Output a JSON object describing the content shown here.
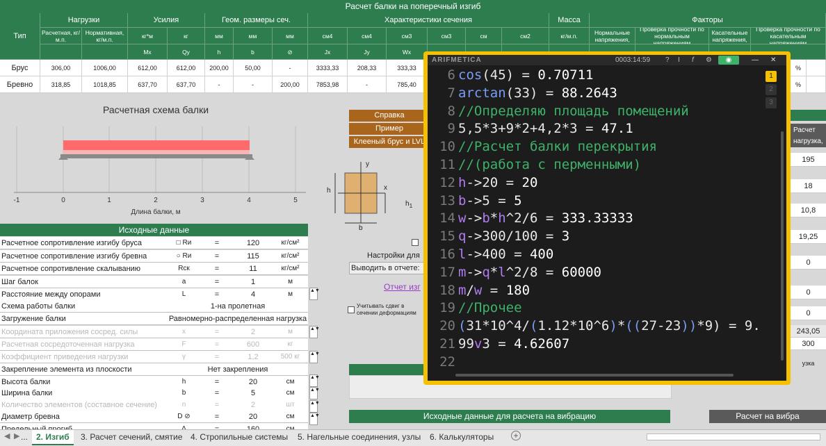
{
  "title": "Расчет балки на поперечный изгиб",
  "table_header": {
    "tip": "Тип",
    "groups": [
      "Нагрузки",
      "Усилия",
      "Геом. размеры сеч.",
      "Характеристики сечения",
      "Масса",
      "Факторы"
    ],
    "sub": [
      "Расчетная, кг/м.п.",
      "Нормативная, кг/м.п.",
      "кг*м",
      "кг",
      "мм",
      "мм",
      "мм",
      "см4",
      "см4",
      "см3",
      "см3",
      "см",
      "см2",
      "кг/м.п.",
      "Нормальные напряжения,",
      "Проверка прочности по нормальным напряжениям",
      "Касательные напряжения,",
      "Проверка прочности по касательным напряжениям"
    ],
    "sub2": [
      "",
      "",
      "Mx",
      "Qy",
      "h",
      "b",
      "⊘",
      "Jx",
      "Jy",
      "Wx"
    ]
  },
  "rows": [
    {
      "name": "Брус",
      "cells": [
        "306,00",
        "1006,00",
        "612,00",
        "612,00",
        "200,00",
        "50,00",
        "-",
        "3333,33",
        "208,33",
        "333,33"
      ]
    },
    {
      "name": "Бревно",
      "cells": [
        "318,85",
        "1018,85",
        "637,70",
        "637,70",
        "-",
        "-",
        "200,00",
        "7853,98",
        "-",
        "785,40"
      ]
    }
  ],
  "scheme": {
    "title": "Расчетная схема балки",
    "axis_label": "Длина балки, м",
    "ticks": [
      "-1",
      "0",
      "1",
      "2",
      "3",
      "4",
      "5"
    ]
  },
  "buttons": [
    "Справка",
    "Пример",
    "Клееный брус и LVL"
  ],
  "section_labels": {
    "y": "y",
    "x": "x",
    "h": "h",
    "b": "b",
    "h1": "h1"
  },
  "input": {
    "title": "Исходные данные",
    "rows": [
      {
        "label": "Расчетное сопротивление изгибу бруса",
        "sym": "□ Rи",
        "val": "120",
        "unit": "кг/см²"
      },
      {
        "label": "Расчетное сопротивление изгибу бревна",
        "sym": "○ Rи",
        "val": "115",
        "unit": "кг/см²"
      },
      {
        "label": "Расчетное сопротивление скалыванию",
        "sym": "Rск",
        "val": "11",
        "unit": "кг/см²"
      },
      {
        "label": "Шаг балок",
        "sym": "a",
        "val": "1",
        "unit": "м"
      },
      {
        "label": "Расстояние между опорами",
        "sym": "L",
        "val": "4",
        "unit": "м"
      }
    ],
    "scheme_row": {
      "label": "Схема работы балки",
      "value": "1-на пролетная"
    },
    "load_row": {
      "label": "Загружение балки",
      "value": "Равномерно-распределенная нагрузка"
    },
    "disabled": [
      {
        "label": "Координата приложения сосред. силы",
        "sym": "x",
        "val": "2",
        "unit": "м"
      },
      {
        "label": "Расчетная сосредоточенная нагрузка",
        "sym": "F",
        "val": "600",
        "unit": "кг"
      },
      {
        "label": "Коэффициент приведения нагрузки",
        "sym": "γ",
        "val": "1,2",
        "unit": "500 кг"
      }
    ],
    "fix_row": {
      "label": "Закрепление элемента из плоскости",
      "value": "Нет закрепления"
    },
    "geom": [
      {
        "label": "Высота балки",
        "sym": "h",
        "val": "20",
        "unit": "см"
      },
      {
        "label": "Ширина балки",
        "sym": "b",
        "val": "5",
        "unit": "см"
      }
    ],
    "count": {
      "label": "Количество элементов (составное сечение)",
      "sym": "n",
      "val": "2",
      "unit": "шт"
    },
    "diam": {
      "label": "Диаметр бревна",
      "sym": "D ⊘",
      "val": "20",
      "unit": "см"
    },
    "limit": {
      "label": "Предельный прогиб",
      "sym": "Δ",
      "val": "160",
      "unit": "см"
    }
  },
  "report": {
    "settings": "Настройки для",
    "output": "Выводить в отчете:",
    "link": "Отчет изг",
    "shear_check": "Учитывать сдвиг в сечении деформациям",
    "vibration": "Исходные данные для расчета на вибрацию",
    "vibration_right": "Расчет на вибра"
  },
  "right_panel": {
    "header": "Расчет нагрузка, к",
    "values": [
      "195",
      "18",
      "10,8",
      "19,25",
      "0",
      "0",
      "0"
    ],
    "v1": "243,05",
    "v2": "300",
    "note": "узка",
    "top_row1": "%",
    "top_row2": "%"
  },
  "arifmetica": {
    "brand": "ARIFMETICA",
    "time": "0003:14:59",
    "controls": [
      "?",
      "I",
      "f",
      "⚙",
      "◉",
      "—",
      "✕"
    ],
    "pages": [
      "1",
      "2",
      "3"
    ],
    "lines": [
      {
        "n": "6",
        "parts": [
          [
            "fn",
            "cos"
          ],
          [
            "num",
            "(45) = "
          ],
          [
            "res",
            "0.70711"
          ]
        ]
      },
      {
        "n": "7",
        "parts": [
          [
            "fn",
            "arctan"
          ],
          [
            "num",
            "(33) = "
          ],
          [
            "res",
            "88.2643"
          ]
        ]
      },
      {
        "n": "8",
        "parts": [
          [
            "cmt",
            "//Определяю площадь помещений"
          ]
        ]
      },
      {
        "n": "9",
        "parts": [
          [
            "num",
            "5,5*3+9*2+4,2*3 = "
          ],
          [
            "res",
            "47.1"
          ]
        ]
      },
      {
        "n": "10",
        "parts": [
          [
            "cmt",
            "//Расчет балки перекрытия"
          ]
        ]
      },
      {
        "n": "11",
        "parts": [
          [
            "cmt",
            "//(работа с перменными)"
          ]
        ]
      },
      {
        "n": "12",
        "parts": [
          [
            "var",
            "h"
          ],
          [
            "num",
            "->20 = "
          ],
          [
            "res",
            "20"
          ]
        ]
      },
      {
        "n": "13",
        "parts": [
          [
            "var",
            "b"
          ],
          [
            "num",
            "->5 = "
          ],
          [
            "res",
            "5"
          ]
        ]
      },
      {
        "n": "14",
        "parts": [
          [
            "var",
            "w"
          ],
          [
            "num",
            "->"
          ],
          [
            "var",
            "b"
          ],
          [
            "num",
            "*"
          ],
          [
            "var",
            "h"
          ],
          [
            "num",
            "^2/6 = "
          ],
          [
            "res",
            "333.33333"
          ]
        ]
      },
      {
        "n": "15",
        "parts": [
          [
            "var",
            "q"
          ],
          [
            "num",
            "->300/100 = "
          ],
          [
            "res",
            "3"
          ]
        ]
      },
      {
        "n": "16",
        "parts": [
          [
            "var",
            "l"
          ],
          [
            "num",
            "->400 = "
          ],
          [
            "res",
            "400"
          ]
        ]
      },
      {
        "n": "17",
        "parts": [
          [
            "var",
            "m"
          ],
          [
            "num",
            "->"
          ],
          [
            "var",
            "q"
          ],
          [
            "num",
            "*"
          ],
          [
            "var",
            "l"
          ],
          [
            "num",
            "^2/8 = "
          ],
          [
            "res",
            "60000"
          ]
        ]
      },
      {
        "n": "18",
        "parts": [
          [
            "var",
            "m"
          ],
          [
            "num",
            "/"
          ],
          [
            "var",
            "w"
          ],
          [
            "num",
            " = "
          ],
          [
            "res",
            "180"
          ]
        ]
      },
      {
        "n": "19",
        "parts": [
          [
            "cmt",
            "//Прочее"
          ]
        ]
      },
      {
        "n": "20",
        "parts": [
          [
            "fn",
            "("
          ],
          [
            "num",
            "31*10^4/"
          ],
          [
            "fn",
            "("
          ],
          [
            "num",
            "1.12*10^6"
          ],
          [
            "fn",
            ")"
          ],
          [
            "num",
            "*"
          ],
          [
            "fn",
            "(("
          ],
          [
            "num",
            "27-23"
          ],
          [
            "fn",
            "))"
          ],
          [
            "num",
            "*9) = 9."
          ]
        ]
      },
      {
        "n": "21",
        "parts": [
          [
            "num",
            "99"
          ],
          [
            "var",
            "v"
          ],
          [
            "num",
            "3 = "
          ],
          [
            "res",
            "4.62607"
          ]
        ]
      },
      {
        "n": "22",
        "parts": []
      }
    ]
  },
  "tabs": [
    "...",
    "2. Изгиб",
    "3. Расчет сечений, смятие",
    "4. Стропильные системы",
    "5. Нагельные соединения, узлы",
    "6. Калькуляторы"
  ],
  "colors": {
    "green": "#2e7d4f",
    "brown": "#a9651c",
    "yellow": "#f5c000"
  }
}
